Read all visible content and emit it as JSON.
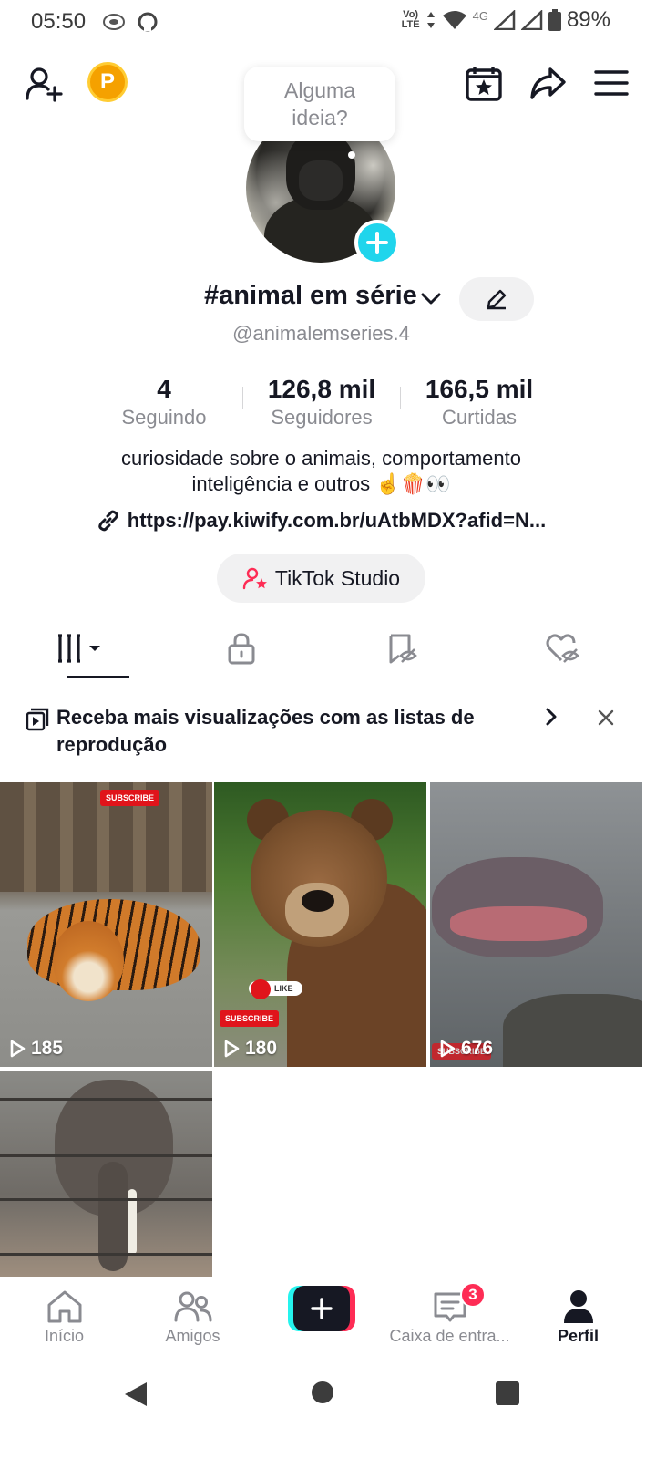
{
  "status_bar": {
    "time": "05:50",
    "network_label": "Vo) LTE",
    "signal_label": "4G",
    "battery": "89%"
  },
  "top_bar": {
    "coin_letter": "P",
    "idea_bubble": "Alguma ideia?"
  },
  "profile": {
    "name": "#animal em série",
    "username": "@animalemseries.4",
    "stats": [
      {
        "value": "4",
        "label": "Seguindo"
      },
      {
        "value": "126,8 mil",
        "label": "Seguidores"
      },
      {
        "value": "166,5 mil",
        "label": "Curtidas"
      }
    ],
    "bio_line1": "curiosidade sobre o animais, comportamento",
    "bio_line2": "inteligência e outros ☝️🍿👀",
    "link": "https://pay.kiwify.com.br/uAtbMDX?afid=N...",
    "studio_button": "TikTok Studio"
  },
  "playlist_banner": {
    "text": "Receba mais visualizações com as listas de reprodução"
  },
  "videos": [
    {
      "views": "185",
      "subject": "tiger",
      "badges": [
        "SUBSCRIBE"
      ]
    },
    {
      "views": "180",
      "subject": "bear",
      "badges": [
        "LIKE",
        "SUBSCRIBE"
      ]
    },
    {
      "views": "676",
      "subject": "hippo",
      "badges": [
        "SUBSCRIBE"
      ]
    },
    {
      "views": "",
      "subject": "elephant",
      "badges": []
    }
  ],
  "bottom_nav": {
    "items": [
      {
        "label": "Início",
        "icon": "home-icon"
      },
      {
        "label": "Amigos",
        "icon": "friends-icon"
      },
      {
        "label": "",
        "icon": "create-icon"
      },
      {
        "label": "Caixa de entra...",
        "icon": "inbox-icon",
        "badge": "3"
      },
      {
        "label": "Perfil",
        "icon": "profile-icon"
      }
    ]
  },
  "colors": {
    "accent_red": "#fe2c55",
    "accent_cyan": "#25f4ee",
    "avatar_plus": "#20d5ec",
    "text_primary": "#161823",
    "text_secondary": "#8a8b91"
  }
}
